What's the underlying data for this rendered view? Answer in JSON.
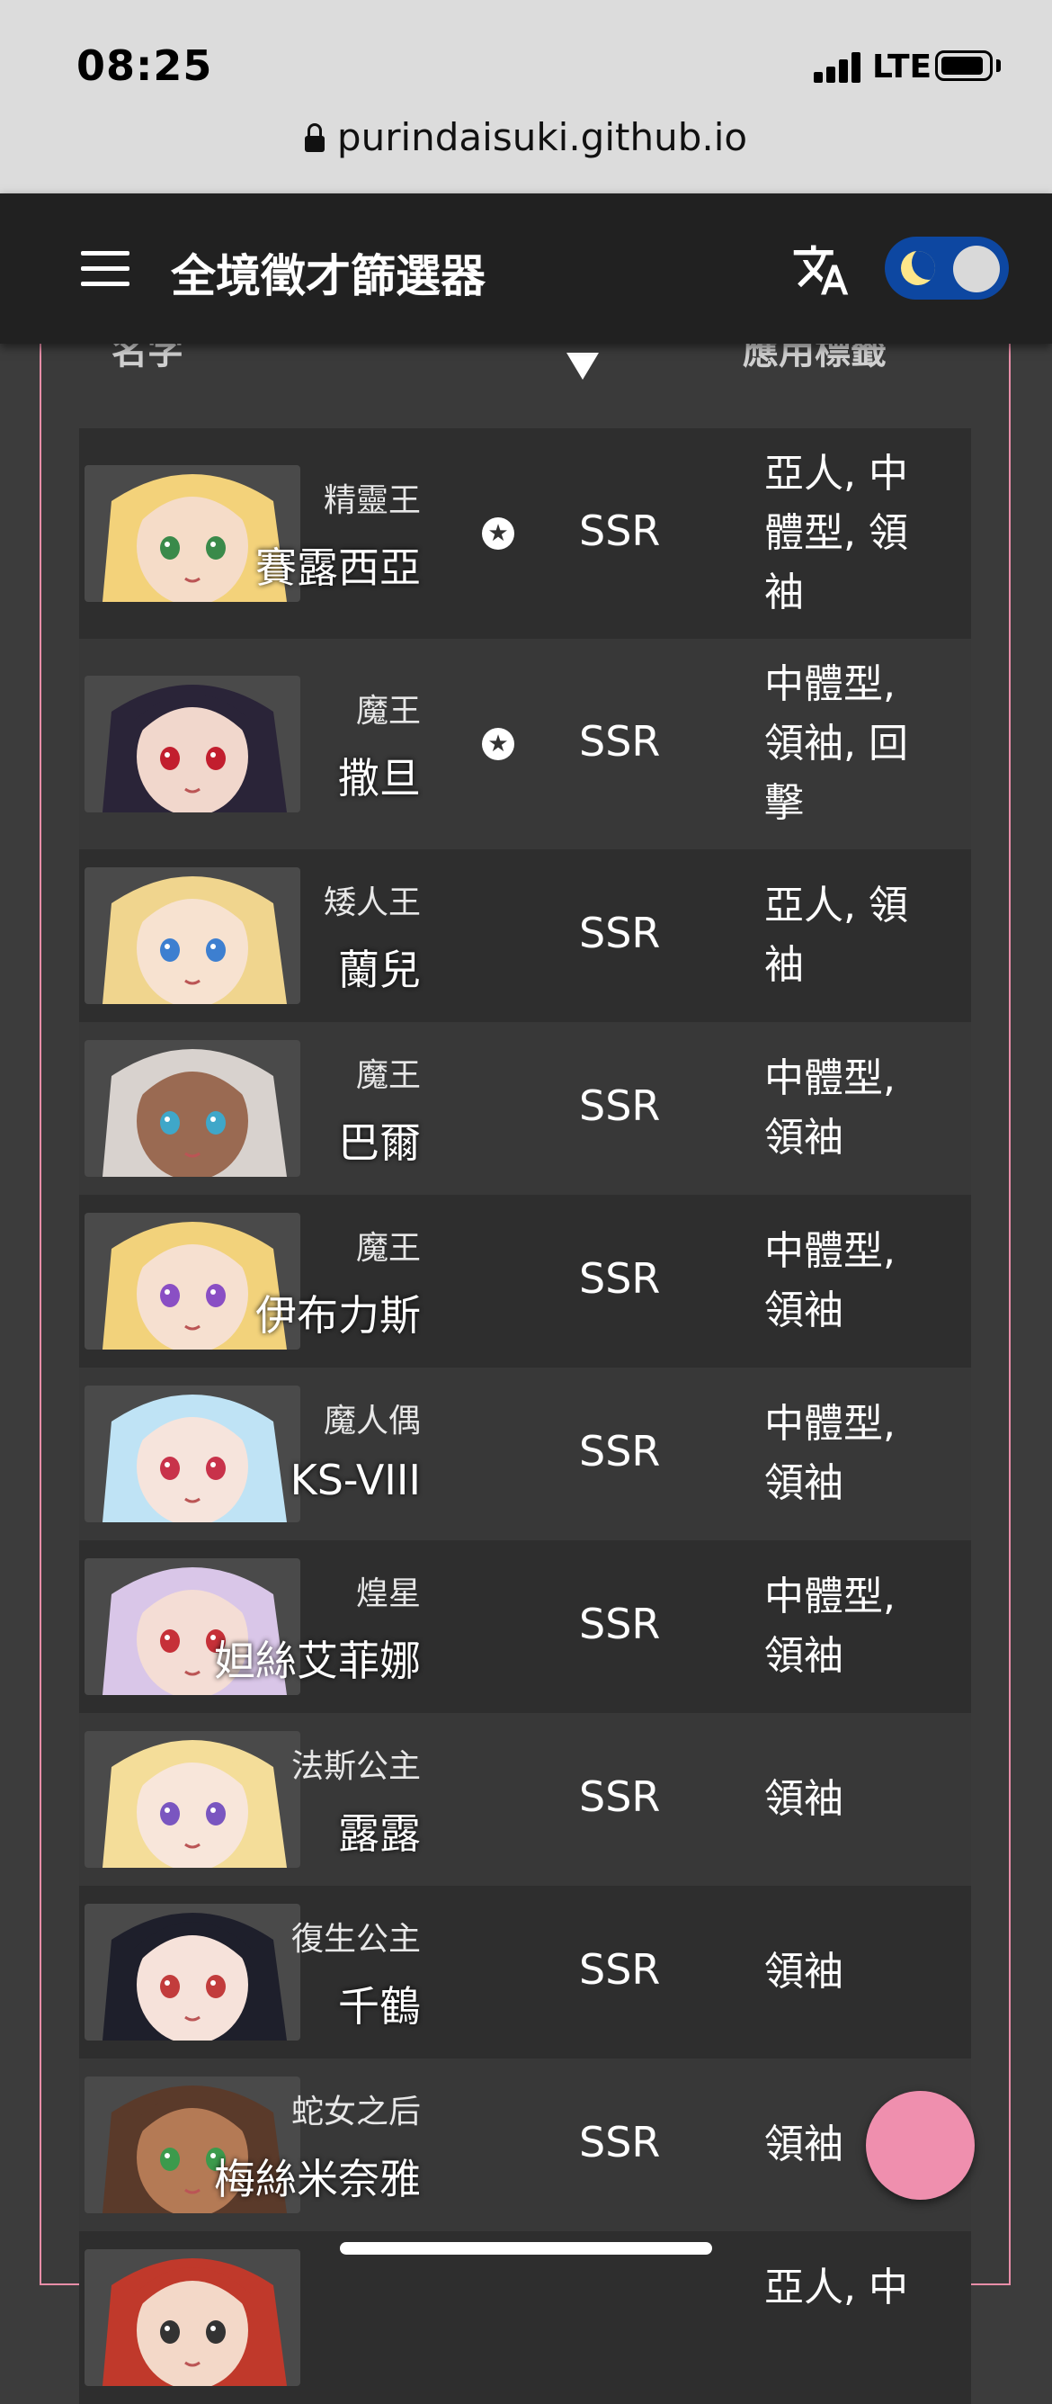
{
  "status_bar": {
    "time": "08:25",
    "network": "LTE"
  },
  "browser": {
    "url": "purindaisuki.github.io"
  },
  "app_bar": {
    "title": "全境徵才篩選器"
  },
  "table": {
    "headers": {
      "name": "名字",
      "tags": "應用標籤"
    },
    "rows": [
      {
        "title": "精靈王",
        "name": "賽露西亞",
        "favorite": true,
        "rarity": "SSR",
        "tags": "亞人, 中體型, 領袖",
        "hair": "#f3d27a",
        "skin": "#f5dcc8",
        "eye": "#3a8a4a"
      },
      {
        "title": "魔王",
        "name": "撒旦",
        "favorite": true,
        "rarity": "SSR",
        "tags": "中體型, 領袖, 回擊",
        "hair": "#2a2438",
        "skin": "#f1d7cc",
        "eye": "#c21e2e"
      },
      {
        "title": "矮人王",
        "name": "蘭兒",
        "favorite": false,
        "rarity": "SSR",
        "tags": "亞人, 領袖",
        "hair": "#f0d58e",
        "skin": "#f7e2d0",
        "eye": "#3d7fd0"
      },
      {
        "title": "魔王",
        "name": "巴爾",
        "favorite": false,
        "rarity": "SSR",
        "tags": "中體型, 領袖",
        "hair": "#d8d2ce",
        "skin": "#9a6a52",
        "eye": "#3fa7c9"
      },
      {
        "title": "魔王",
        "name": "伊布力斯",
        "favorite": false,
        "rarity": "SSR",
        "tags": "中體型, 領袖",
        "hair": "#f2d27b",
        "skin": "#f6e0d0",
        "eye": "#8a4fc4"
      },
      {
        "title": "魔人偶",
        "name": "KS-VIII",
        "favorite": false,
        "rarity": "SSR",
        "tags": "中體型, 領袖",
        "hair": "#bfe3f5",
        "skin": "#f6e4dc",
        "eye": "#c8324a"
      },
      {
        "title": "煌星",
        "name": "妲絲艾菲娜",
        "favorite": false,
        "rarity": "SSR",
        "tags": "中體型, 領袖",
        "hair": "#d9c6e8",
        "skin": "#f4ddd5",
        "eye": "#c63038"
      },
      {
        "title": "法斯公主",
        "name": "露露",
        "favorite": false,
        "rarity": "SSR",
        "tags": "領袖",
        "hair": "#f4dd99",
        "skin": "#f8e6da",
        "eye": "#7a56c0"
      },
      {
        "title": "復生公主",
        "name": "千鶴",
        "favorite": false,
        "rarity": "SSR",
        "tags": "領袖",
        "hair": "#1e1f2b",
        "skin": "#f6e2da",
        "eye": "#c23c3c"
      },
      {
        "title": "蛇女之后",
        "name": "梅絲米奈雅",
        "favorite": false,
        "rarity": "SSR",
        "tags": "領袖",
        "hair": "#5a3a2a",
        "skin": "#b47a55",
        "eye": "#3c9a4c"
      },
      {
        "title": "",
        "name": "",
        "favorite": false,
        "rarity": "",
        "tags": "亞人, 中",
        "hair": "#c0392b",
        "skin": "#f3d8c8",
        "eye": "#333333"
      }
    ]
  }
}
